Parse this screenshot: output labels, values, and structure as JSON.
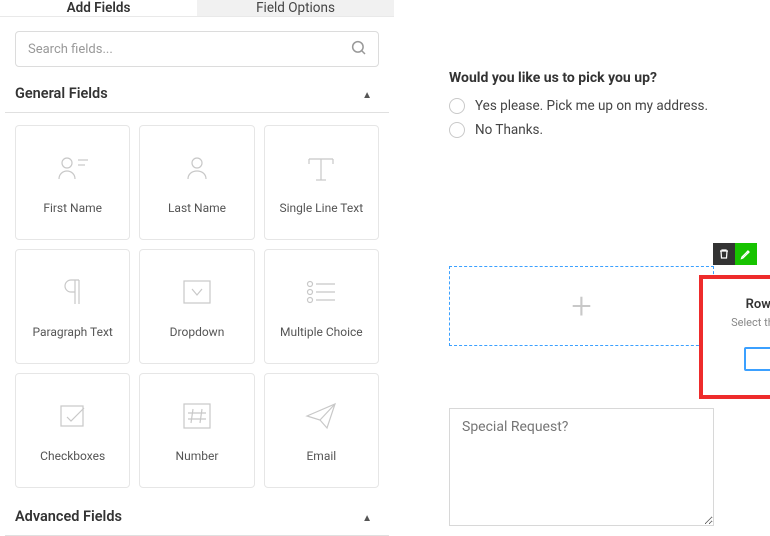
{
  "tabs": {
    "add_fields": "Add Fields",
    "field_options": "Field Options"
  },
  "search": {
    "placeholder": "Search fields..."
  },
  "sections": {
    "general": "General Fields",
    "advanced": "Advanced Fields"
  },
  "fields": {
    "first_name": "First Name",
    "last_name": "Last Name",
    "single_line_text": "Single Line Text",
    "paragraph_text": "Paragraph Text",
    "dropdown": "Dropdown",
    "multiple_choice": "Multiple Choice",
    "checkboxes": "Checkboxes",
    "number": "Number",
    "email": "Email"
  },
  "form": {
    "question": "Would you like us to pick you up?",
    "option_yes": "Yes please. Pick me up on my address.",
    "option_no": "No Thanks.",
    "special_request_placeholder": "Special Request?"
  },
  "popover": {
    "title": "Row Settings",
    "subtitle": "Select the type of row"
  },
  "icons": {
    "plus": "+"
  }
}
